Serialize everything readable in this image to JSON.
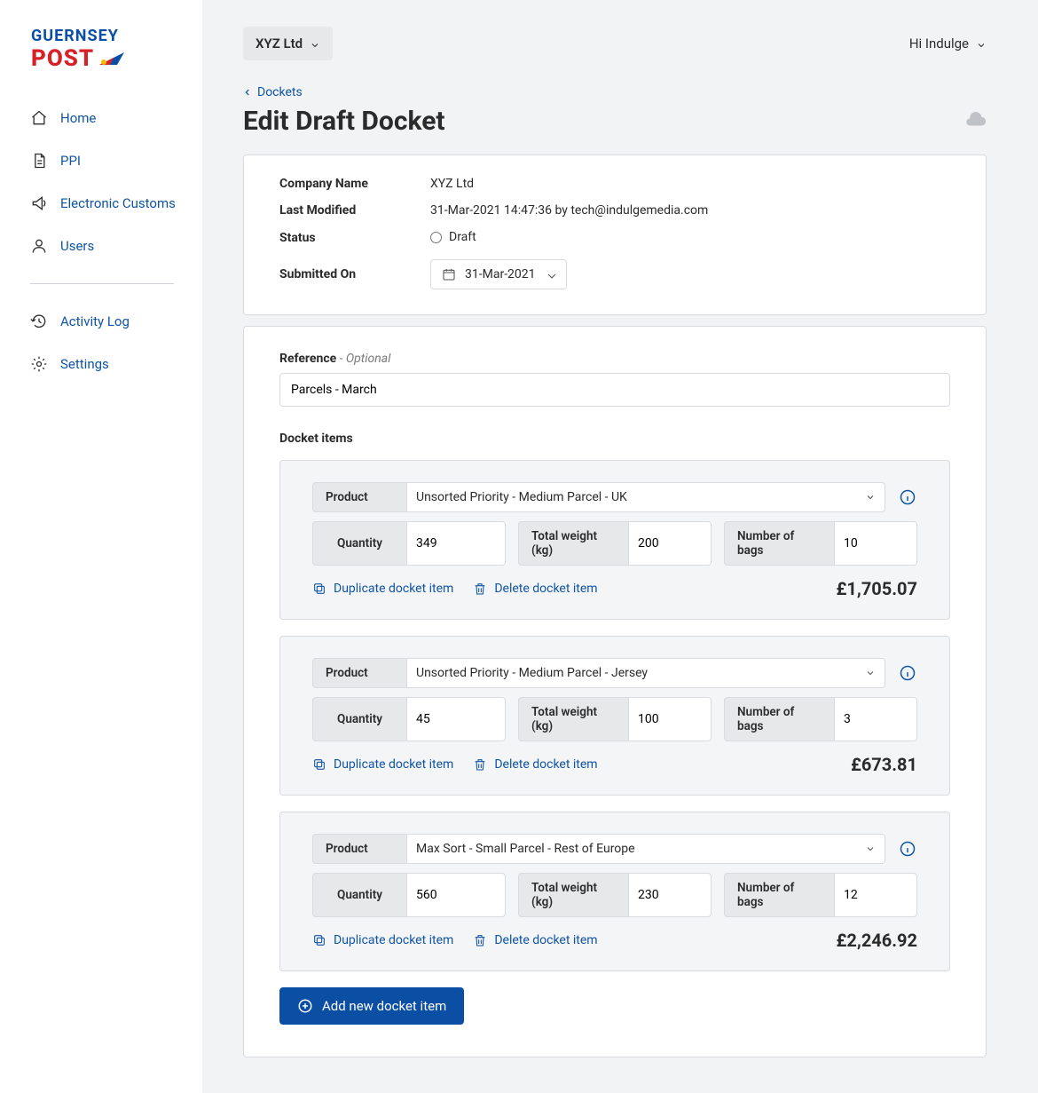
{
  "brand": {
    "line1": "GUERNSEY",
    "line2": "POST"
  },
  "sidebar": {
    "items": [
      {
        "label": "Home"
      },
      {
        "label": "PPI"
      },
      {
        "label": "Electronic Customs"
      },
      {
        "label": "Users"
      }
    ],
    "utility": [
      {
        "label": "Activity Log"
      },
      {
        "label": "Settings"
      }
    ]
  },
  "header": {
    "org": "XYZ Ltd",
    "greeting": "Hi Indulge"
  },
  "breadcrumb": {
    "back_label": "Dockets"
  },
  "page": {
    "title": "Edit Draft Docket"
  },
  "meta": {
    "company_label": "Company Name",
    "company_value": "XYZ Ltd",
    "modified_label": "Last Modified",
    "modified_value": "31-Mar-2021 14:47:36 by tech@indulgemedia.com",
    "status_label": "Status",
    "status_value": "Draft",
    "submitted_label": "Submitted On",
    "submitted_value": "31-Mar-2021"
  },
  "form": {
    "reference_label": "Reference",
    "reference_optional": " - Optional",
    "reference_value": "Parcels - March",
    "items_label": "Docket items",
    "product_label": "Product",
    "quantity_label": "Quantity",
    "weight_label": "Total weight (kg)",
    "bags_label": "Number of bags",
    "duplicate_label": "Duplicate docket item",
    "delete_label": "Delete docket item",
    "add_label": "Add new docket item",
    "items": [
      {
        "product": "Unsorted Priority - Medium Parcel - UK",
        "quantity": "349",
        "weight": "200",
        "bags": "10",
        "price": "£1,705.07"
      },
      {
        "product": "Unsorted Priority - Medium Parcel - Jersey",
        "quantity": "45",
        "weight": "100",
        "bags": "3",
        "price": "£673.81"
      },
      {
        "product": "Max Sort - Small Parcel - Rest of Europe",
        "quantity": "560",
        "weight": "230",
        "bags": "12",
        "price": "£2,246.92"
      }
    ]
  }
}
